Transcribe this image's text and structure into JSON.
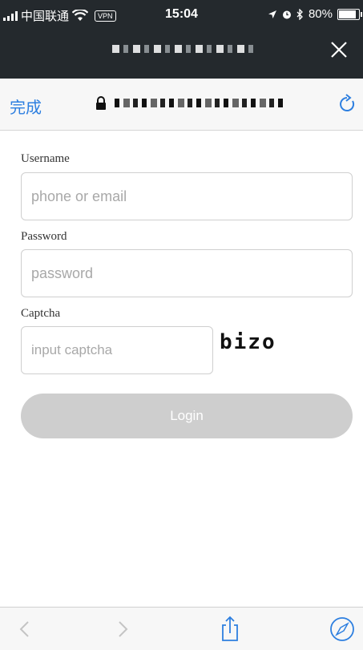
{
  "status_bar": {
    "carrier": "中国联通",
    "vpn": "VPN",
    "time": "15:04",
    "battery": "80%"
  },
  "address_bar": {
    "done_label": "完成"
  },
  "form": {
    "username_label": "Username",
    "username_placeholder": "phone or email",
    "password_label": "Password",
    "password_placeholder": "password",
    "captcha_label": "Captcha",
    "captcha_placeholder": "input captcha",
    "captcha_text": "bizo",
    "login_label": "Login"
  },
  "colors": {
    "header_bg": "#24292d",
    "link_blue": "#2d7fe0",
    "button_disabled": "#cecece"
  },
  "icons": [
    "wifi-icon",
    "location-arrow-icon",
    "alarm-icon",
    "bluetooth-icon",
    "battery-icon",
    "close-icon",
    "lock-icon",
    "reload-icon",
    "back-arrow-icon",
    "forward-arrow-icon",
    "share-icon",
    "safari-compass-icon"
  ]
}
